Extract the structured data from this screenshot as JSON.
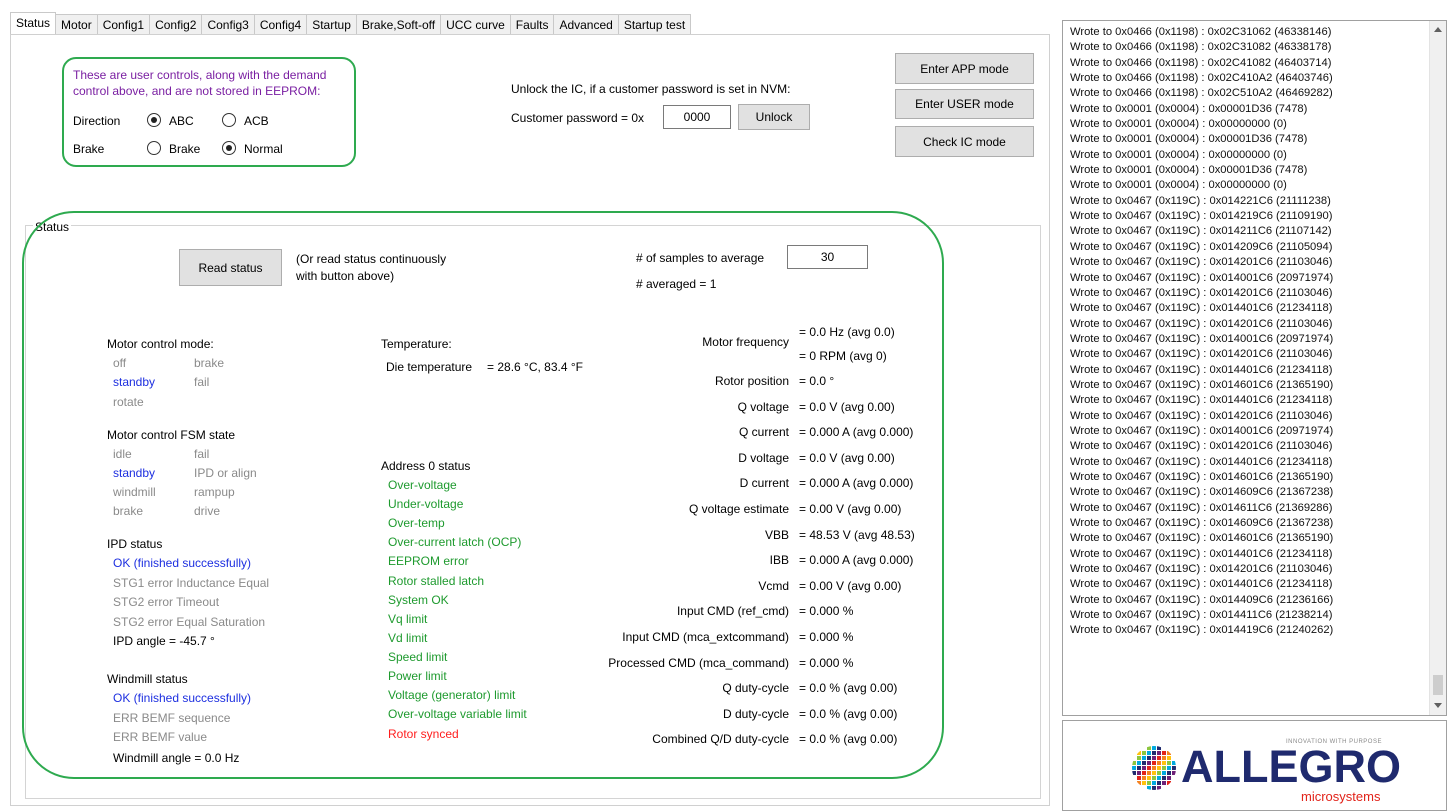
{
  "tabs": [
    "Status",
    "Motor",
    "Config1",
    "Config2",
    "Config3",
    "Config4",
    "Startup",
    "Brake,Soft-off",
    "UCC curve",
    "Faults",
    "Advanced",
    "Startup test"
  ],
  "user_controls": {
    "note_line1": "These are user controls, along with the demand",
    "note_line2": "control above, and are not stored in EEPROM:",
    "direction_label": "Direction",
    "dir_abc": "ABC",
    "dir_acb": "ACB",
    "brake_label": "Brake",
    "brake_brake": "Brake",
    "brake_normal": "Normal"
  },
  "unlock": {
    "text": "Unlock the IC, if a customer password is set in NVM:",
    "password_label": "Customer password = 0x",
    "password_value": "0000",
    "unlock_button": "Unlock"
  },
  "mode_buttons": {
    "enter_app": "Enter APP mode",
    "enter_user": "Enter USER mode",
    "check_ic": "Check IC mode"
  },
  "status_group": {
    "title": "Status",
    "read_button": "Read status",
    "read_note1": "(Or read status continuously",
    "read_note2": "with button above)",
    "samples_label": "# of samples to average",
    "samples_value": "30",
    "averaged": "# averaged = 1"
  },
  "motor_control_mode": {
    "title": "Motor control mode:",
    "off": "off",
    "brake": "brake",
    "standby": "standby",
    "fail": "fail",
    "rotate": "rotate"
  },
  "fsm_state": {
    "title": "Motor control FSM state",
    "idle": "idle",
    "fail": "fail",
    "standby": "standby",
    "ipd": "IPD or align",
    "windmill": "windmill",
    "rampup": "rampup",
    "brake": "brake",
    "drive": "drive"
  },
  "ipd_status": {
    "title": "IPD status",
    "ok": "OK (finished successfully)",
    "stg1": "STG1 error Inductance Equal",
    "stg2_timeout": "STG2 error Timeout",
    "stg2_sat": "STG2 error Equal Saturation",
    "angle": "IPD angle  = -45.7 °"
  },
  "windmill_status": {
    "title": "Windmill status",
    "ok": "OK (finished successfully)",
    "err_seq": "ERR BEMF sequence",
    "err_val": "ERR BEMF value",
    "angle": "Windmill angle  = 0.0 Hz"
  },
  "temperature": {
    "title": "Temperature:",
    "die_label": "Die temperature",
    "die_value": "= 28.6 °C, 83.4 °F"
  },
  "address0": {
    "title": "Address 0 status",
    "items": [
      "Over-voltage",
      "Under-voltage",
      "Over-temp",
      "Over-current latch (OCP)",
      "EEPROM error",
      "Rotor stalled latch",
      "System OK",
      "Vq limit",
      "Vd limit",
      "Speed limit",
      "Power limit",
      "Voltage (generator) limit",
      "Over-voltage variable limit"
    ],
    "alert": "Rotor synced"
  },
  "measurements": {
    "motor_freq_label": "Motor frequency",
    "motor_freq_hz": "= 0.0 Hz (avg 0.0)",
    "motor_freq_rpm": "= 0 RPM (avg 0)",
    "rows": [
      {
        "label": "Rotor position",
        "value": "= 0.0 °"
      },
      {
        "label": "Q voltage",
        "value": "= 0.0 V (avg 0.00)"
      },
      {
        "label": "Q current",
        "value": "= 0.000 A (avg 0.000)"
      },
      {
        "label": "D voltage",
        "value": "= 0.0 V (avg 0.00)"
      },
      {
        "label": "D current",
        "value": "= 0.000 A (avg 0.000)"
      },
      {
        "label": "Q voltage estimate",
        "value": "= 0.00 V (avg 0.00)"
      },
      {
        "label": "VBB",
        "value": "= 48.53 V (avg 48.53)"
      },
      {
        "label": "IBB",
        "value": "= 0.000 A (avg 0.000)"
      },
      {
        "label": "Vcmd",
        "value": "= 0.00 V (avg 0.00)"
      },
      {
        "label": "Input CMD (ref_cmd)",
        "value": "= 0.000 %"
      },
      {
        "label": "Input CMD (mca_extcommand)",
        "value": "= 0.000 %"
      },
      {
        "label": "Processed CMD (mca_command)",
        "value": "= 0.000 %"
      },
      {
        "label": "Q duty-cycle",
        "value": "= 0.0 % (avg 0.00)"
      },
      {
        "label": "D duty-cycle",
        "value": "= 0.0 % (avg 0.00)"
      },
      {
        "label": "Combined Q/D duty-cycle",
        "value": "= 0.0 % (avg 0.00)"
      }
    ]
  },
  "log": [
    "Wrote to 0x0466 (0x1198) : 0x02C31062 (46338146)",
    "Wrote to 0x0466 (0x1198) : 0x02C31082 (46338178)",
    "Wrote to 0x0466 (0x1198) : 0x02C41082 (46403714)",
    "Wrote to 0x0466 (0x1198) : 0x02C410A2 (46403746)",
    "Wrote to 0x0466 (0x1198) : 0x02C510A2 (46469282)",
    "Wrote to 0x0001 (0x0004) : 0x00001D36 (7478)",
    "Wrote to 0x0001 (0x0004) : 0x00000000 (0)",
    "Wrote to 0x0001 (0x0004) : 0x00001D36 (7478)",
    "Wrote to 0x0001 (0x0004) : 0x00000000 (0)",
    "Wrote to 0x0001 (0x0004) : 0x00001D36 (7478)",
    "Wrote to 0x0001 (0x0004) : 0x00000000 (0)",
    "Wrote to 0x0467 (0x119C) : 0x014221C6 (21111238)",
    "Wrote to 0x0467 (0x119C) : 0x014219C6 (21109190)",
    "Wrote to 0x0467 (0x119C) : 0x014211C6 (21107142)",
    "Wrote to 0x0467 (0x119C) : 0x014209C6 (21105094)",
    "Wrote to 0x0467 (0x119C) : 0x014201C6 (21103046)",
    "Wrote to 0x0467 (0x119C) : 0x014001C6 (20971974)",
    "Wrote to 0x0467 (0x119C) : 0x014201C6 (21103046)",
    "Wrote to 0x0467 (0x119C) : 0x014401C6 (21234118)",
    "Wrote to 0x0467 (0x119C) : 0x014201C6 (21103046)",
    "Wrote to 0x0467 (0x119C) : 0x014001C6 (20971974)",
    "Wrote to 0x0467 (0x119C) : 0x014201C6 (21103046)",
    "Wrote to 0x0467 (0x119C) : 0x014401C6 (21234118)",
    "Wrote to 0x0467 (0x119C) : 0x014601C6 (21365190)",
    "Wrote to 0x0467 (0x119C) : 0x014401C6 (21234118)",
    "Wrote to 0x0467 (0x119C) : 0x014201C6 (21103046)",
    "Wrote to 0x0467 (0x119C) : 0x014001C6 (20971974)",
    "Wrote to 0x0467 (0x119C) : 0x014201C6 (21103046)",
    "Wrote to 0x0467 (0x119C) : 0x014401C6 (21234118)",
    "Wrote to 0x0467 (0x119C) : 0x014601C6 (21365190)",
    "Wrote to 0x0467 (0x119C) : 0x014609C6 (21367238)",
    "Wrote to 0x0467 (0x119C) : 0x014611C6 (21369286)",
    "Wrote to 0x0467 (0x119C) : 0x014609C6 (21367238)",
    "Wrote to 0x0467 (0x119C) : 0x014601C6 (21365190)",
    "Wrote to 0x0467 (0x119C) : 0x014401C6 (21234118)",
    "Wrote to 0x0467 (0x119C) : 0x014201C6 (21103046)",
    "Wrote to 0x0467 (0x119C) : 0x014401C6 (21234118)",
    "Wrote to 0x0467 (0x119C) : 0x014409C6 (21236166)",
    "Wrote to 0x0467 (0x119C) : 0x014411C6 (21238214)",
    "Wrote to 0x0467 (0x119C) : 0x014419C6 (21240262)"
  ],
  "logo": {
    "tagline": "INNOVATION WITH PURPOSE",
    "name": "ALLEGRO",
    "sub": "microsystems",
    "brand_red": "#e2231a",
    "brand_navy": "#1f2a6e"
  },
  "colors": {
    "highlight_green": "#2eaa4f",
    "status_green": "#1e9a2e",
    "status_blue": "#1d2fe0",
    "alert_red": "#ff1e1e",
    "note_purple": "#7a1fa2"
  }
}
